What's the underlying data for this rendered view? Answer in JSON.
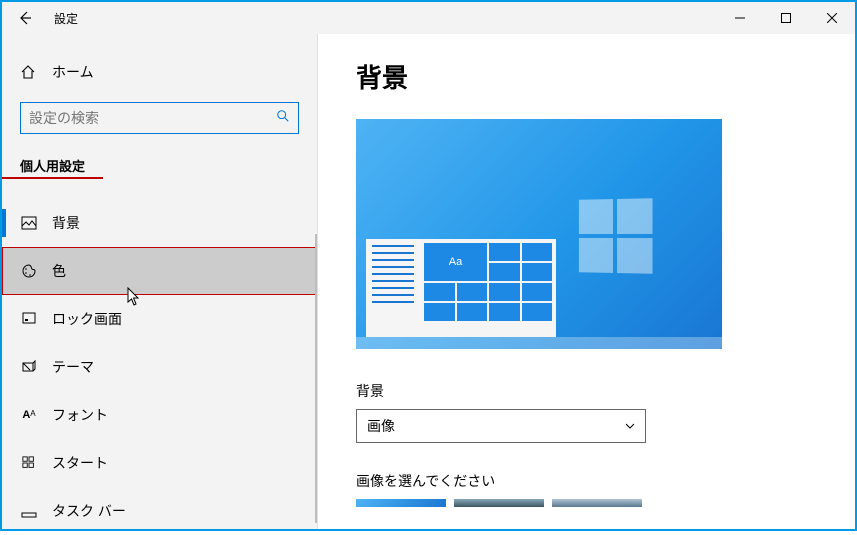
{
  "titlebar": {
    "title": "設定"
  },
  "sidebar": {
    "home": "ホーム",
    "search_placeholder": "設定の検索",
    "section": "個人用設定",
    "items": [
      {
        "label": "背景"
      },
      {
        "label": "色"
      },
      {
        "label": "ロック画面"
      },
      {
        "label": "テーマ"
      },
      {
        "label": "フォント"
      },
      {
        "label": "スタート"
      },
      {
        "label": "タスク バー"
      }
    ]
  },
  "main": {
    "heading": "背景",
    "preview_tile_text": "Aa",
    "bg_label": "背景",
    "bg_dropdown": "画像",
    "choose_label": "画像を選んでください"
  }
}
